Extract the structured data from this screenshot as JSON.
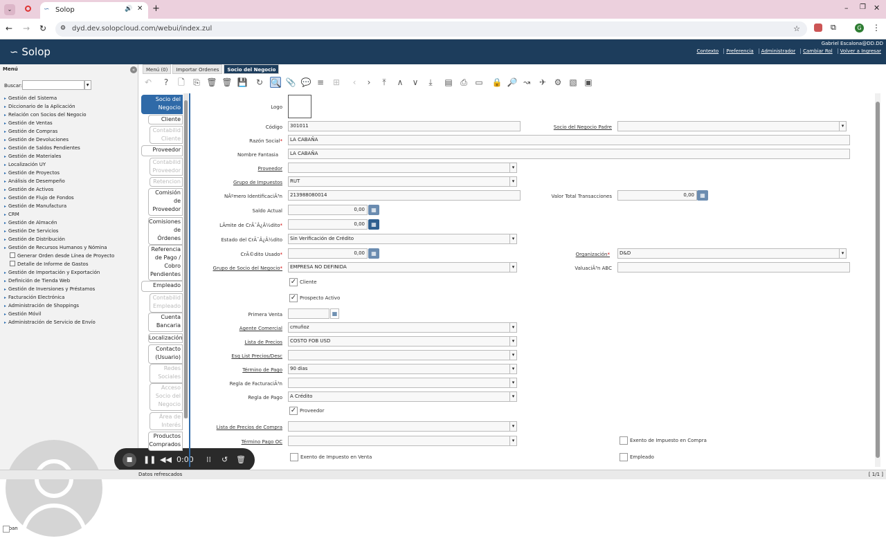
{
  "browser": {
    "tab_title": "Solop",
    "url": "dyd.dev.solopcloud.com/webui/index.zul"
  },
  "app": {
    "logo": "Solop",
    "user": "Gabriel Escalona@DD.DD",
    "links": [
      "Contexto",
      "Preferencia",
      "Administrador",
      "Cambiar Rol",
      "Volver a Ingresar"
    ]
  },
  "menu": {
    "title": "Menú",
    "search_label": "Buscar:",
    "items": [
      {
        "label": "Gestión del Sistema",
        "type": "folder"
      },
      {
        "label": "Diccionario de la Aplicación",
        "type": "folder"
      },
      {
        "label": "Relación con Socios del Negocio",
        "type": "folder"
      },
      {
        "label": "Gestión de Ventas",
        "type": "folder"
      },
      {
        "label": "Gestión de Compras",
        "type": "folder"
      },
      {
        "label": "Gestión de Devoluciones",
        "type": "folder"
      },
      {
        "label": "Gestión de Saldos Pendientes",
        "type": "folder"
      },
      {
        "label": "Gestión de Materiales",
        "type": "folder"
      },
      {
        "label": "Localización UY",
        "type": "folder"
      },
      {
        "label": "Gestión de Proyectos",
        "type": "folder"
      },
      {
        "label": "Análisis de Desempeño",
        "type": "folder"
      },
      {
        "label": "Gestión de Activos",
        "type": "folder"
      },
      {
        "label": "Gestión de Flujo de Fondos",
        "type": "folder"
      },
      {
        "label": "Gestión de Manufactura",
        "type": "folder"
      },
      {
        "label": "CRM",
        "type": "folder"
      },
      {
        "label": "Gestión de Almacén",
        "type": "folder"
      },
      {
        "label": "Gestión De Servicios",
        "type": "folder"
      },
      {
        "label": "Gestión de Distribución",
        "type": "folder"
      },
      {
        "label": "Gestión de Recursos Humanos y Nómina",
        "type": "folder"
      },
      {
        "label": "Generar Orden desde Línea de Proyecto",
        "type": "sub"
      },
      {
        "label": "Detalle de Informe de Gastos",
        "type": "sub"
      },
      {
        "label": "Gestión de Importación y Exportación",
        "type": "folder"
      },
      {
        "label": "Definición de Tienda Web",
        "type": "folder"
      },
      {
        "label": "Gestión de Inversiones y Préstamos",
        "type": "folder"
      },
      {
        "label": "Facturación Electrónica",
        "type": "folder"
      },
      {
        "label": "Administración de Shoppings",
        "type": "folder"
      },
      {
        "label": "Gestión Móvil",
        "type": "folder"
      },
      {
        "label": "Administración de Servicio de Envío",
        "type": "folder"
      }
    ],
    "expand_label": "Expan"
  },
  "recorder": {
    "time": "0:00"
  },
  "window_tabs": [
    "Menú (0)",
    "Importar Ordenes",
    "Socio del Negocio"
  ],
  "side_tabs": [
    "Socio del Negocio",
    "Cliente",
    "Contabilid Cliente",
    "Proveedor",
    "Contabilid Proveedor",
    "Retencion",
    "Comisión de Proveedor",
    "Comisiones de Órdenes",
    "Referencia de Pago / Cobro Pendientes",
    "Empleado",
    "Contabilid Empleado",
    "Cuenta Bancaria",
    "Localización",
    "Contacto (Usuario)",
    "Redes Sociales",
    "Acceso Socio del Negocio",
    "Área de Interés",
    "Productos Comprados"
  ],
  "form": {
    "logo_label": "Logo",
    "codigo_label": "Código",
    "codigo": "301011",
    "padre_label": "Socio del Negocio Padre",
    "padre": "",
    "razon_label": "Razón Social",
    "razon": "LA CABAÑA",
    "fantasia_label": "Nombre Fantasia",
    "fantasia": "LA CABAÑA",
    "proveedor_label": "Proveedor",
    "proveedor": "",
    "grupo_imp_label": "Grupo de Impuestos",
    "grupo_imp": "RUT",
    "numero_label": "NÂºmero IdentificaciÃ³n",
    "numero": "213988080014",
    "valor_label": "Valor Total Transacciones",
    "valor": "0,00",
    "saldo_label": "Saldo Actual",
    "saldo": "0,00",
    "limite_label": "LÃmite de CrÃ¯Â¿Â½dito",
    "limite": "0,00",
    "estado_label": "Estado del CrÃ¯Â¿Â½dito",
    "estado": "Sin Verificación de Crédito",
    "credito_label": "CrÃ©dito Usado",
    "credito": "0,00",
    "org_label": "Organización",
    "org": "D&D",
    "grupo_socio_label": "Grupo de Socio del Negocio",
    "grupo_socio": "EMPRESA NO DEFINIDA",
    "abc_label": "ValuaciÃ³n ABC",
    "abc": "",
    "cliente_cb": "Cliente",
    "prospecto_cb": "Prospecto Activo",
    "primera_label": "Primera Venta",
    "primera": "",
    "agente_label": "Agente Comercial",
    "agente": "cmuñoz",
    "lista_label": "Lista de Precios",
    "lista": "COSTO FOB USD",
    "esq_label": "Esq List Precios/Desc",
    "esq": "",
    "termino_label": "Término de Pago",
    "termino": "90 dias",
    "regla_fact_label": "Regla de FacturaciÃ³n",
    "regla_fact": "",
    "regla_pago_label": "Regla de Pago",
    "regla_pago": "A Crédito",
    "proveedor_cb": "Proveedor",
    "lista_compra_label": "Lista de Precios de Compra",
    "lista_compra": "",
    "termino_oc_label": "Término Pago OC",
    "termino_oc": "",
    "exento_compra": "Exento de Impuesto en Compra",
    "exento_venta": "Exento de Impuesto en Venta",
    "empleado_cb": "Empleado"
  },
  "status": {
    "text": "Datos refrescados",
    "page": "[ 1/1 ]"
  }
}
